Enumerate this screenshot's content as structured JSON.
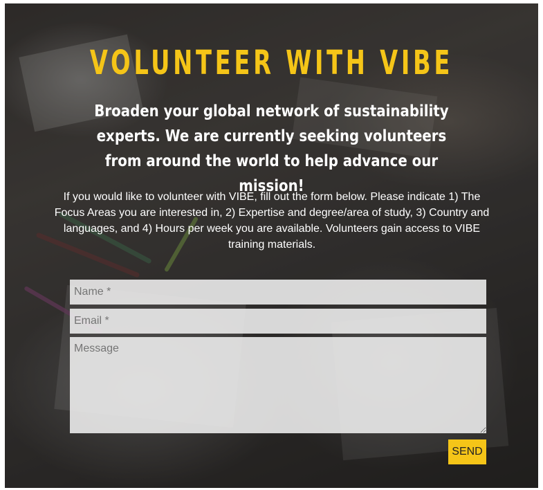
{
  "page": {
    "title": "VOLUNTEER WITH VIBE",
    "subtitle": "Broaden your global network of sustainability experts. We are currently seeking volunteers from around the world to help advance our mission!",
    "intro": "If you would like to volunteer with VIBE, fill out the form below. Please indicate 1) The Focus Areas you are interested in, 2) Expertise and degree/area of study, 3) Country and languages, and 4) Hours per week you are available. Volunteers gain access to VIBE training materials."
  },
  "form": {
    "name_placeholder": "Name *",
    "email_placeholder": "Email *",
    "message_placeholder": "Message",
    "send_label": "SEND"
  },
  "colors": {
    "accent": "#f5c518",
    "text": "#ffffff",
    "field_bg": "#f0f0f0"
  }
}
